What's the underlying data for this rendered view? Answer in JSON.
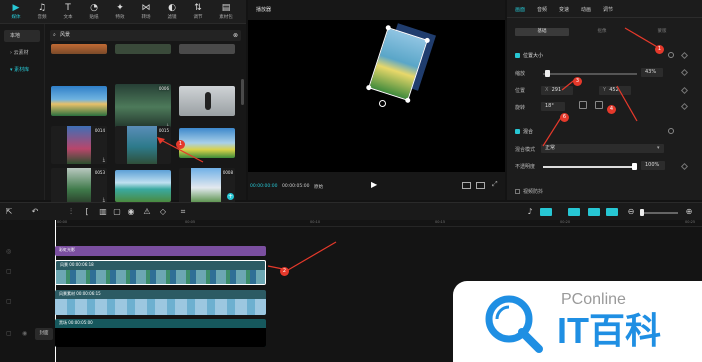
{
  "toolbar": {
    "tabs": [
      {
        "label": "媒体",
        "icon": "media-icon"
      },
      {
        "label": "音频",
        "icon": "audio-icon"
      },
      {
        "label": "文本",
        "icon": "text-icon"
      },
      {
        "label": "贴纸",
        "icon": "sticker-icon"
      },
      {
        "label": "特效",
        "icon": "effects-icon"
      },
      {
        "label": "转场",
        "icon": "transition-icon"
      },
      {
        "label": "滤镜",
        "icon": "filter-icon"
      },
      {
        "label": "调节",
        "icon": "adjust-icon"
      },
      {
        "label": "素材包",
        "icon": "pack-icon"
      }
    ]
  },
  "leftnav": {
    "items": [
      "本地",
      "云素材",
      "素材库"
    ]
  },
  "media": {
    "search_value": "风景",
    "thumbs": [
      {
        "dur": "0015"
      },
      {
        "dur": "0006"
      },
      {
        "dur": "0014"
      },
      {
        "dur": "0015"
      },
      {
        "dur": "0053"
      },
      {
        "dur": "0008"
      },
      {
        "dur": "0028"
      }
    ]
  },
  "player": {
    "title": "播放器",
    "time_current": "00:00:00:00",
    "time_total": "00:00:05:00",
    "ratio_label": "原始"
  },
  "rpanel": {
    "tabs": [
      "画面",
      "音频",
      "变速",
      "动画",
      "调节"
    ],
    "subtabs": [
      "基础",
      "抠像",
      "蒙版"
    ],
    "section_pos": "位置大小",
    "scale_label": "缩放",
    "scale_value": "43%",
    "pos_label": "位置",
    "pos_x_label": "X",
    "pos_x": "291",
    "pos_y_label": "Y",
    "pos_y": "452",
    "rot_label": "旋转",
    "rot_value": "18°",
    "section_blend": "混合",
    "blend_mode_label": "混合模式",
    "blend_mode_value": "正常",
    "opacity_label": "不透明度",
    "opacity_value": "100%",
    "section_stab": "视频防抖",
    "badges": [
      "1",
      "3",
      "4",
      "5",
      "6"
    ]
  },
  "timeline": {
    "ruler_ticks": [
      "00:00",
      "00:05",
      "00:10",
      "00:15",
      "00:20",
      "00:25"
    ],
    "tracks": {
      "fx_label": "彩虹光影",
      "clip1_label": "风景  00:00:06:18",
      "clip2_label": "风景素材  00:00:06:15",
      "clip3_label": "黑场  00:00:05:00"
    },
    "cover_label": "封面",
    "badge2": "2"
  },
  "watermark": {
    "brand": "PConline",
    "name": "IT百科"
  }
}
